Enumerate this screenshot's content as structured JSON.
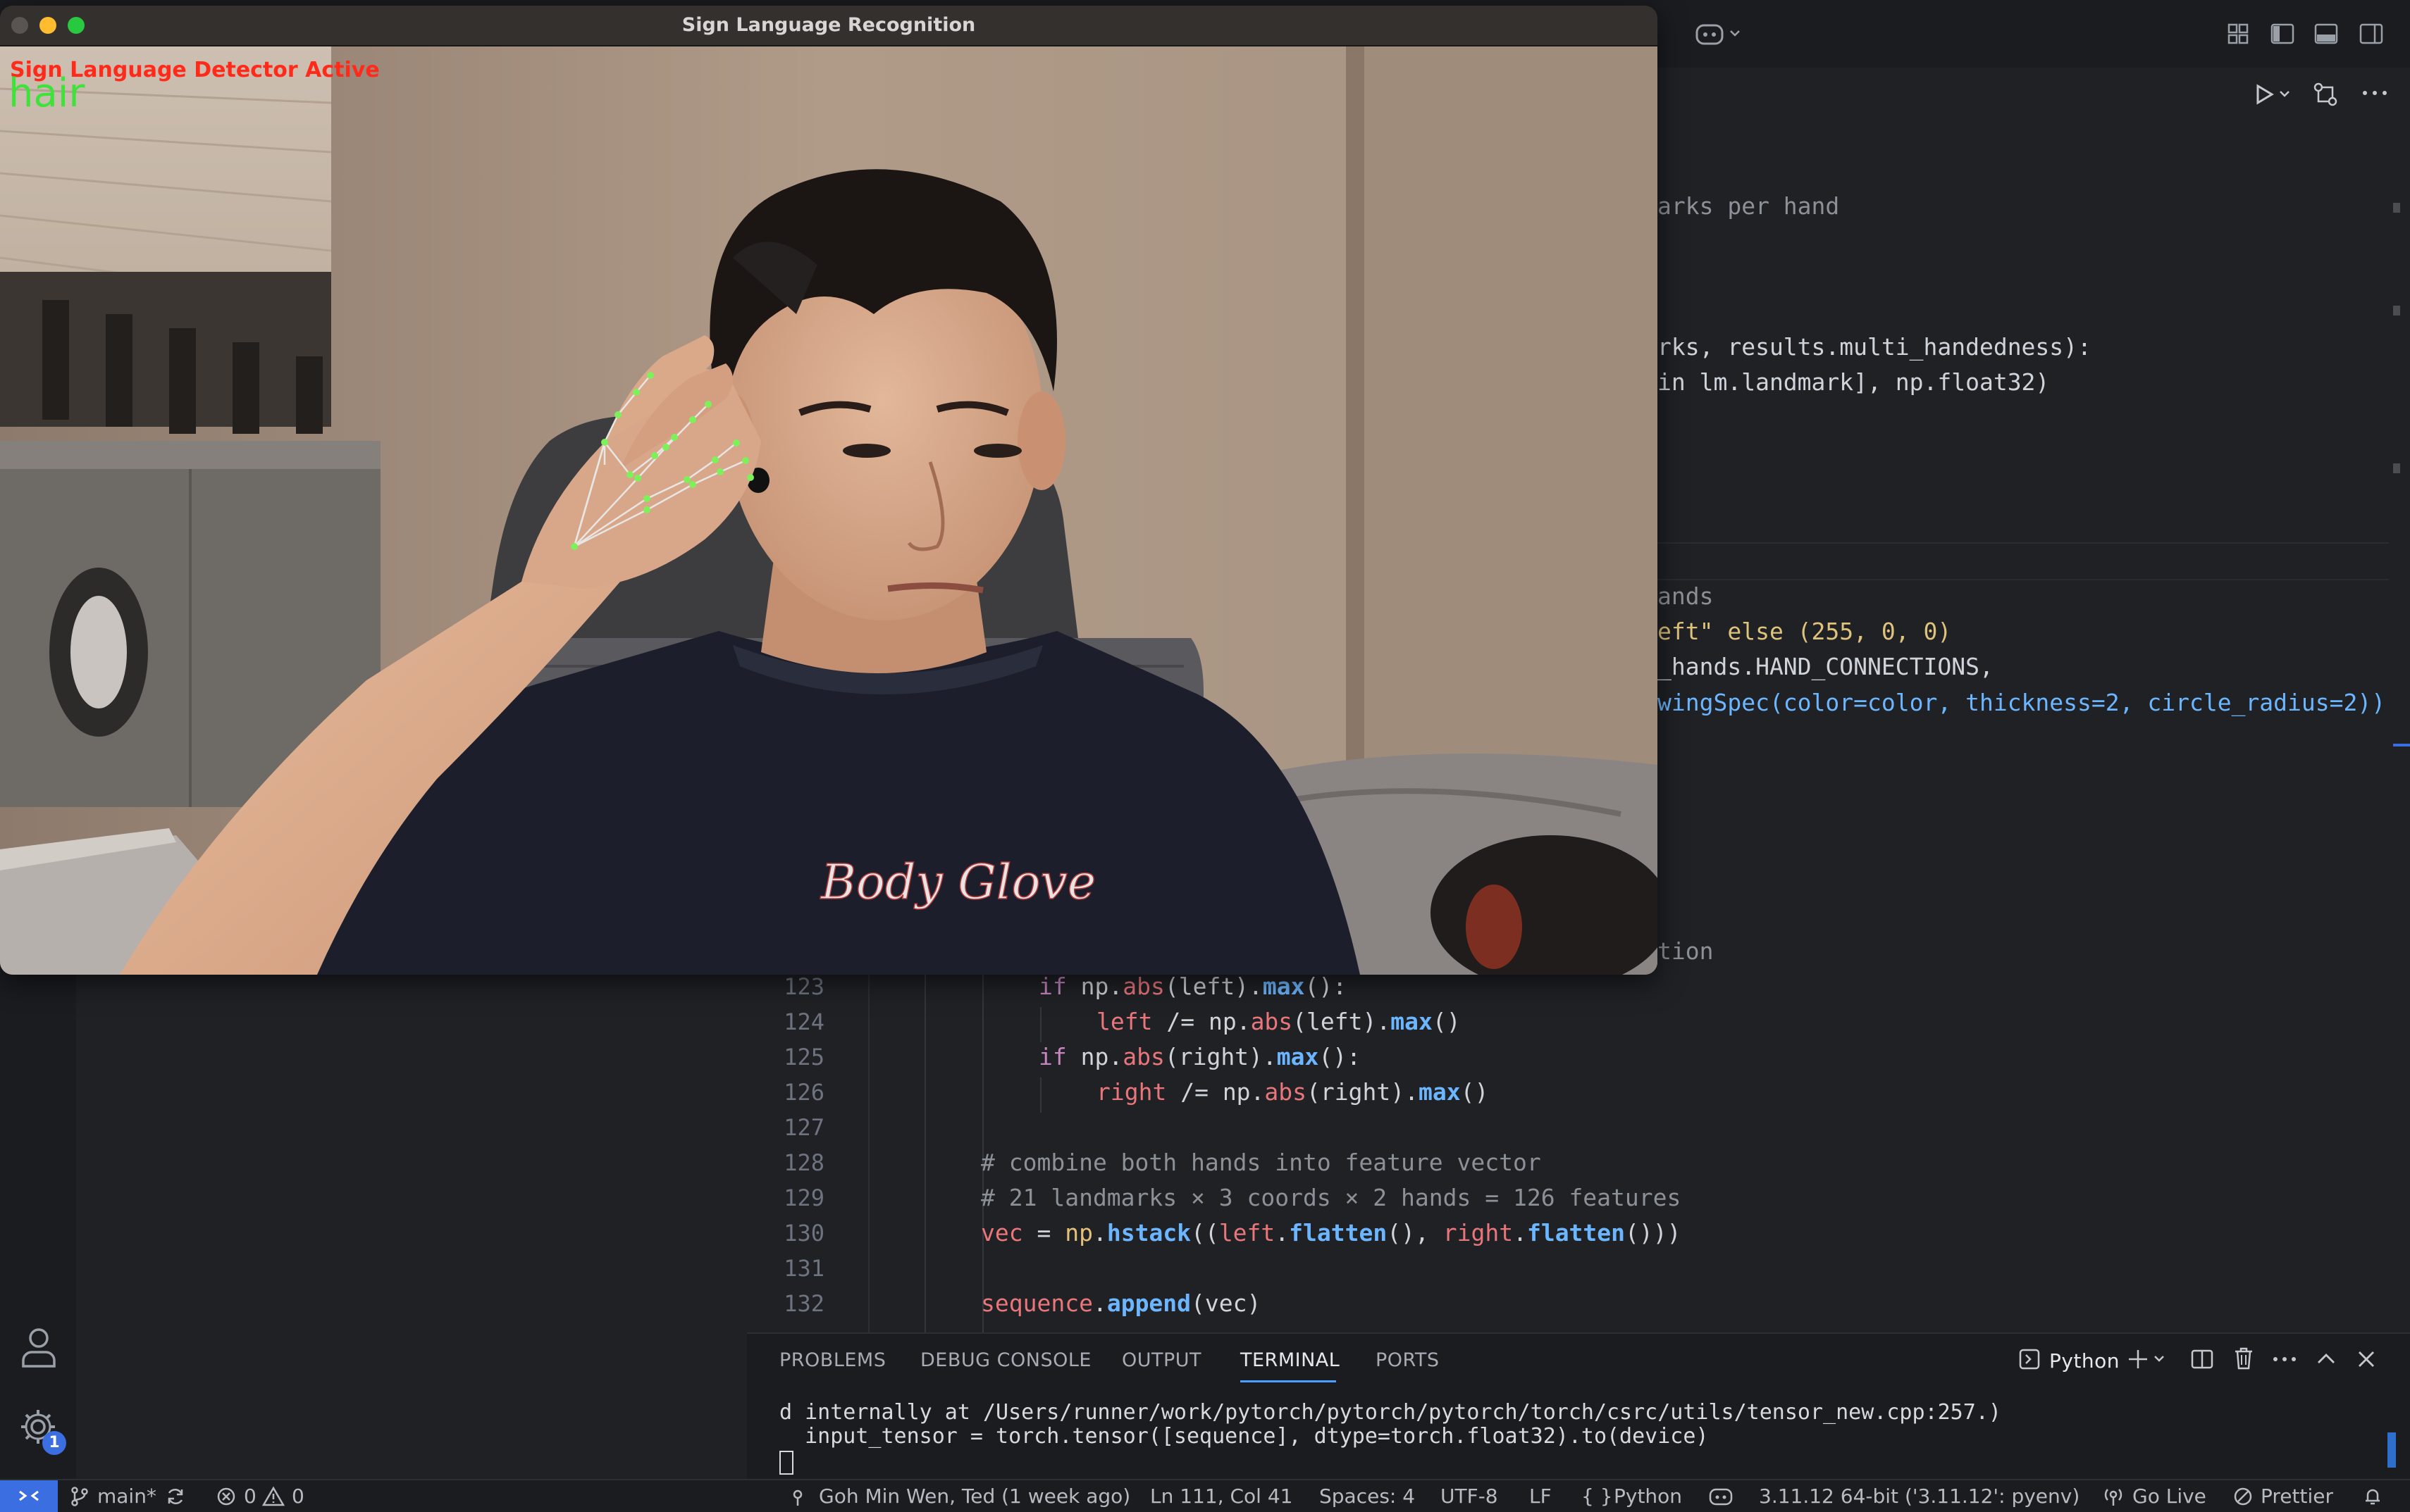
{
  "camera_window": {
    "title": "Sign Language Recognition",
    "overlay_status": "Sign Language Detector Active",
    "prediction": "hair",
    "shirt_print": "Body Glove"
  },
  "editor": {
    "background_fragments": [
      "arks per hand",
      "rks, results.multi_handedness):",
      "in lm.landmark], np.float32)",
      "ands",
      "eft\" else (255, 0, 0)",
      "_hands.HAND_CONNECTIONS,",
      "wingSpec(color=color, thickness=2, circle_radius=2))",
      "tion"
    ],
    "line_numbers": [
      "123",
      "124",
      "125",
      "126",
      "127",
      "128",
      "129",
      "130",
      "131",
      "132"
    ],
    "lines": {
      "l123": [
        "if",
        " np.",
        "abs",
        "(left).",
        "max",
        "():"
      ],
      "l124": [
        "left",
        " /= np.",
        "abs",
        "(left).",
        "max",
        "()"
      ],
      "l125": [
        "if",
        " np.",
        "abs",
        "(right).",
        "max",
        "():"
      ],
      "l126": [
        "right",
        " /= np.",
        "abs",
        "(right).",
        "max",
        "()"
      ],
      "l128": "# combine both hands into feature vector",
      "l129": "# 21 landmarks × 3 coords × 2 hands = 126 features",
      "l130": [
        "vec",
        " = ",
        "np",
        ".",
        "hstack",
        "((",
        "left",
        ".",
        "flatten",
        "(), ",
        "right",
        ".",
        "flatten",
        "()))"
      ],
      "l132": [
        "sequence",
        ".",
        "append",
        "(vec)"
      ]
    }
  },
  "panel": {
    "tabs": [
      "PROBLEMS",
      "DEBUG CONSOLE",
      "OUTPUT",
      "TERMINAL",
      "PORTS"
    ],
    "active_tab": "TERMINAL",
    "shell_label": "Python",
    "terminal_lines": [
      "d internally at /Users/runner/work/pytorch/pytorch/pytorch/torch/csrc/utils/tensor_new.cpp:257.)",
      "  input_tensor = torch.tensor([sequence], dtype=torch.float32).to(device)"
    ]
  },
  "activity": {
    "settings_badge": "1"
  },
  "statusbar": {
    "branch": "main*",
    "errors": "0",
    "warnings": "0",
    "blame": "Goh Min Wen, Ted (1 week ago)",
    "cursor": "Ln 111, Col 41",
    "spaces": "Spaces: 4",
    "encoding": "UTF-8",
    "eol": "LF",
    "language": "Python",
    "interpreter": "3.11.12 64-bit ('3.11.12': pyenv)",
    "go_live": "Go Live",
    "prettier": "Prettier"
  },
  "colors": {
    "accent": "#3b6ee0",
    "tab_underline": "#4b9fff",
    "overlay_status": "#ff2a1a",
    "overlay_prediction": "#3fe23a",
    "landmark": "#7df05a"
  }
}
